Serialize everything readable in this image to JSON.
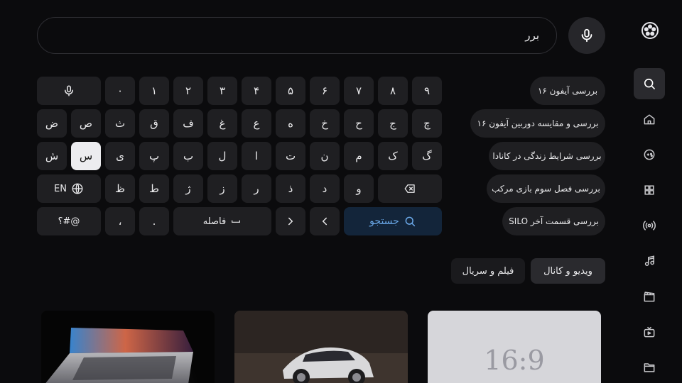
{
  "search": {
    "query": "برر"
  },
  "keyboard": {
    "row1": [
      "٩",
      "٨",
      "٧",
      "۶",
      "۵",
      "۴",
      "٣",
      "٢",
      "١",
      "٠"
    ],
    "row2": [
      "چ",
      "ج",
      "ح",
      "خ",
      "ه",
      "ع",
      "غ",
      "ف",
      "ق",
      "ث",
      "ص",
      "ض"
    ],
    "row3": [
      "گ",
      "ک",
      "م",
      "ن",
      "ت",
      "ا",
      "ل",
      "ب",
      "پ",
      "ی",
      "س",
      "ش"
    ],
    "row4": [
      "و",
      "د",
      "ذ",
      "ر",
      "ز",
      "ژ",
      "ط",
      "ظ"
    ],
    "lang_label": "EN",
    "space_label": "فاصله",
    "search_label": "جستجو",
    "period": ".",
    "comma": "،",
    "symbols_label": "؟#@"
  },
  "suggestions": [
    "بررسی آیفون ۱۶",
    "بررسی و مقایسه دوربین آیفون ۱۶",
    "بررسی شرایط زندگی در کانادا",
    "بررسی فصل سوم بازی مرکب",
    "بررسی قسمت آخر SILO"
  ],
  "tabs": {
    "active": "ویدیو و کانال",
    "inactive": "فیلم و سریال"
  },
  "cards": {
    "placeholder_text": "16:9"
  },
  "icons": {
    "logo": "film-reel-logo-icon",
    "nav": [
      "search-icon",
      "home-icon",
      "gamepad-icon",
      "grid-icon",
      "broadcast-icon",
      "music-icon",
      "clapperboard-icon",
      "tv-icon",
      "folder-icon"
    ]
  },
  "colors": {
    "background": "#0b0b0d",
    "key": "#1f1f22",
    "selected_key": "#ececef",
    "search_accent": "#6aa8e8"
  }
}
